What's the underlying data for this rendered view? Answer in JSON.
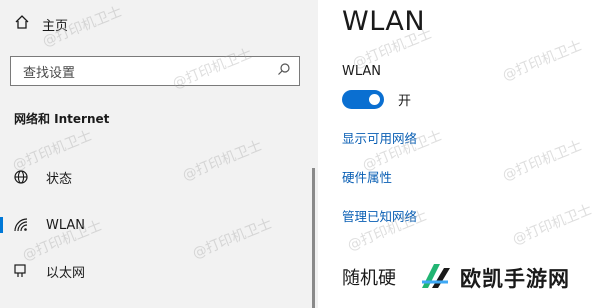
{
  "sidebar": {
    "home_label": "主页",
    "search_placeholder": "查找设置",
    "section_label": "网络和 Internet",
    "items": [
      {
        "label": "状态",
        "icon": "globe-icon"
      },
      {
        "label": "WLAN",
        "icon": "wifi-icon",
        "selected": true
      },
      {
        "label": "以太网",
        "icon": "ethernet-icon"
      }
    ]
  },
  "main": {
    "title": "WLAN",
    "wlan_label": "WLAN",
    "toggle_state": "开",
    "toggle_on": true,
    "links": [
      "显示可用网络",
      "硬件属性",
      "管理已知网络"
    ],
    "sub_heading": "随机硬"
  },
  "branding": {
    "text": "欧凯手游网"
  },
  "watermark": "@打印机卫士",
  "colors": {
    "accent": "#0078d7",
    "link": "#0a5fb4",
    "sidebar_bg": "#f2f2f2"
  }
}
